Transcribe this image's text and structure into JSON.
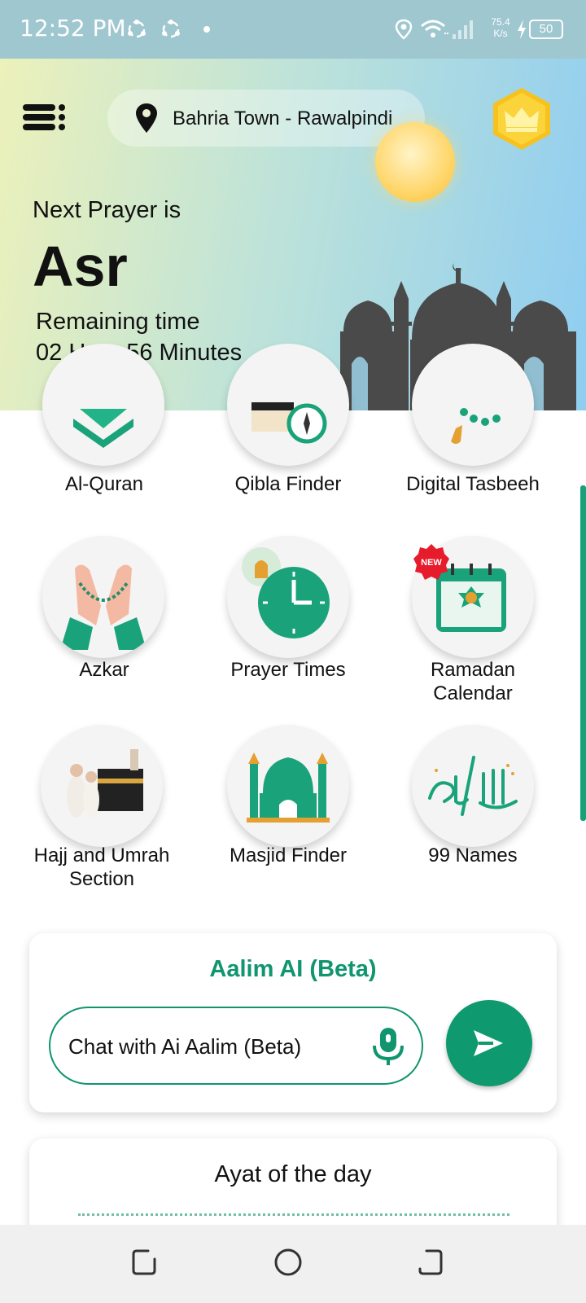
{
  "status_bar": {
    "time": "12:52 PM",
    "speed": "75.4\nK/s",
    "speed_top": "75.4",
    "speed_unit": "K/s",
    "battery": "50"
  },
  "header": {
    "location": "Bahria Town - Rawalpindi",
    "next_prayer_label": "Next Prayer is",
    "next_prayer": "Asr",
    "remaining_label": "Remaining time",
    "remaining_value": "02 Hour 56 Minutes"
  },
  "features": [
    {
      "label": "Al-Quran",
      "icon": "quran-icon"
    },
    {
      "label": "Qibla Finder",
      "icon": "kaaba-compass-icon"
    },
    {
      "label": "Digital Tasbeeh",
      "icon": "tasbeeh-icon"
    },
    {
      "label": "Azkar",
      "icon": "praying-hands-icon"
    },
    {
      "label": "Prayer Times",
      "icon": "prayer-clock-icon"
    },
    {
      "label": "Ramadan\nCalendar",
      "line1": "Ramadan",
      "line2": "Calendar",
      "icon": "calendar-icon",
      "badge": "NEW"
    },
    {
      "label": "Hajj and Umrah\nSection",
      "line1": "Hajj and Umrah",
      "line2": "Section",
      "icon": "kaaba-pilgrims-icon"
    },
    {
      "label": "Masjid Finder",
      "icon": "mosque-icon"
    },
    {
      "label": "99 Names",
      "icon": "calligraphy-icon"
    }
  ],
  "ai_card": {
    "title": "Aalim AI (Beta)",
    "placeholder": "Chat with Ai Aalim (Beta)"
  },
  "ayat_card": {
    "title": "Ayat of the day"
  },
  "colors": {
    "accent": "#0e9a6e",
    "header_left": "#ecf1ba",
    "header_right": "#8fcdf1",
    "status_bar": "#9fc7cf"
  }
}
